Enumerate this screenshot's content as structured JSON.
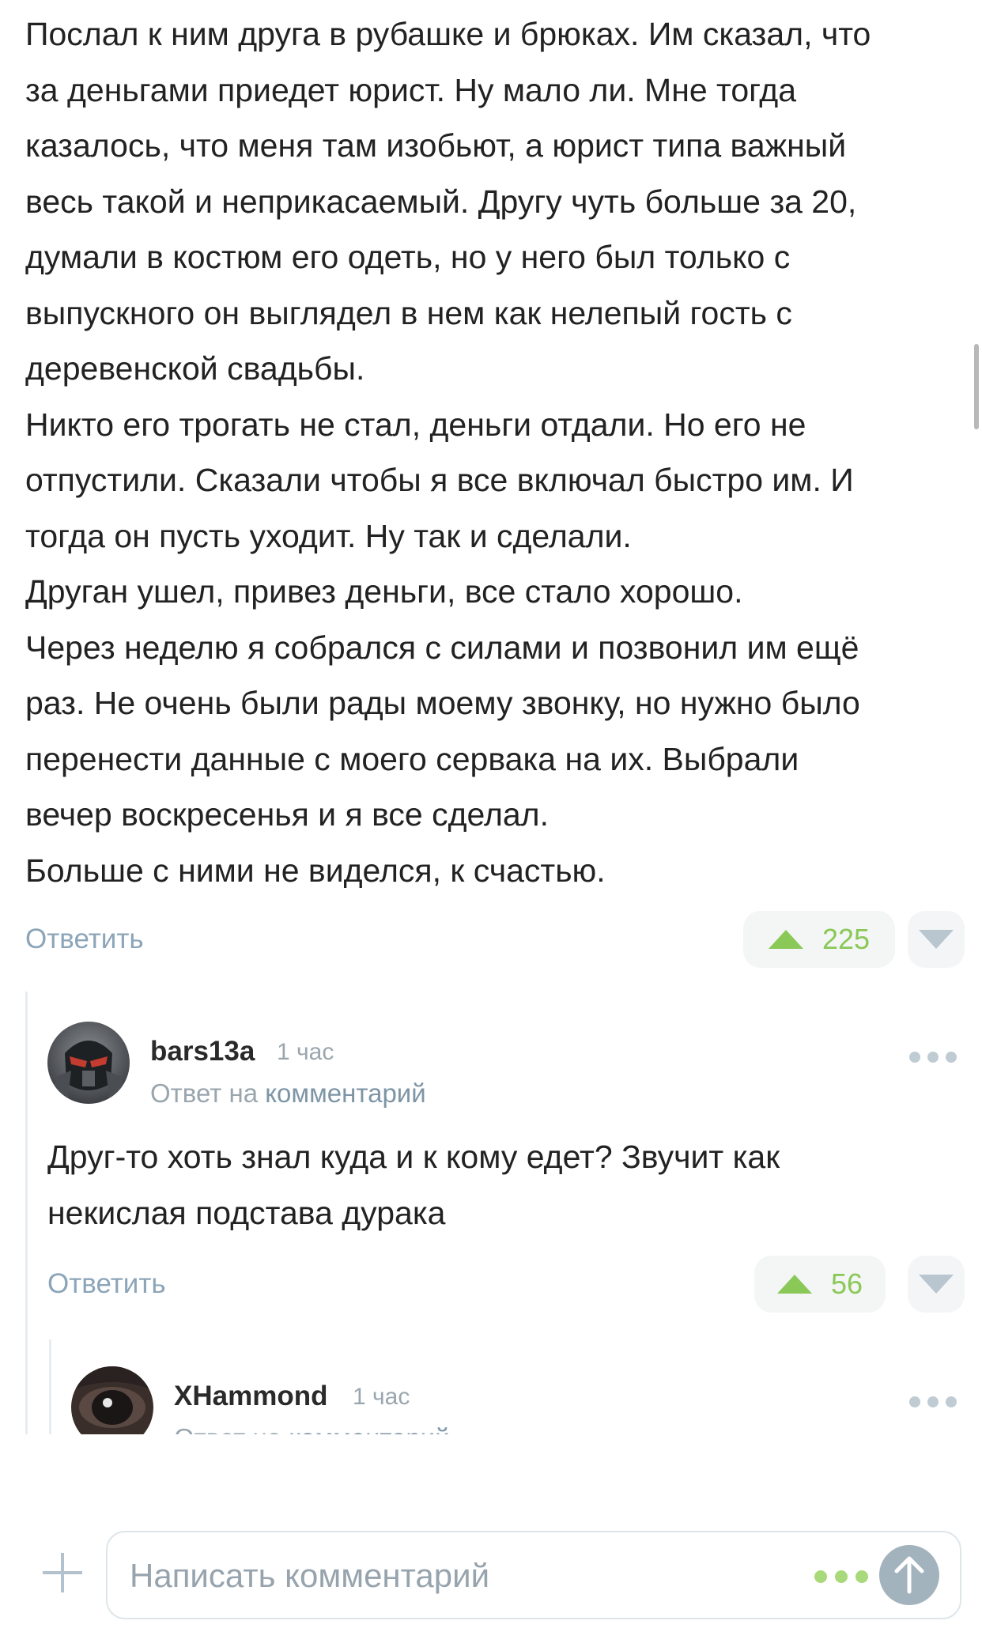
{
  "main_comment": {
    "lines": [
      "Послал к ним друга в рубашке и брюках. Им сказал, что",
      "за деньгами приедет юрист. Ну мало ли. Мне тогда",
      "казалось, что меня там изобьют, а юрист типа важный",
      "весь такой и неприкасаемый. Другу чуть больше за 20,",
      "думали в костюм его одеть, но у него был только с",
      "выпускного он выглядел в нем как нелепый гость с",
      "деревенской свадьбы.",
      "Никто его трогать не стал, деньги отдали. Но его не",
      "отпустили. Сказали чтобы я все включал быстро им. И",
      "тогда он пусть уходит. Ну так и сделали.",
      "Друган ушел, привез деньги, все стало хорошо.",
      "Через неделю я собрался с силами и позвонил им ещё",
      "раз. Не очень были рады моему звонку, но нужно было",
      "перенести данные с моего сервака на их. Выбрали",
      "вечер воскресенья и я все сделал.",
      "Больше с ними не виделся, к счастью."
    ],
    "reply_label": "Ответить",
    "score": "225"
  },
  "reply1": {
    "author": "bars13a",
    "time": "1 час",
    "reply_prefix": "Ответ на",
    "reply_link": "комментарий",
    "lines": [
      "Друг-то хоть знал куда и к кому едет? Звучит как",
      "некислая подстава дурака"
    ],
    "reply_label": "Ответить",
    "score": "56"
  },
  "reply2": {
    "author": "XHammond",
    "time": "1 час",
    "reply_prefix": "Ответ на",
    "reply_link": "комментарий"
  },
  "composer": {
    "placeholder": "Написать комментарий"
  },
  "colors": {
    "upvote": "#8ac858",
    "link": "#8ca5b8",
    "muted": "#9aa6ae"
  },
  "icons": {
    "upvote": "triangle-up-icon",
    "downvote": "triangle-down-icon",
    "more": "more-dots-icon",
    "add": "plus-icon",
    "send": "arrow-up-icon"
  }
}
